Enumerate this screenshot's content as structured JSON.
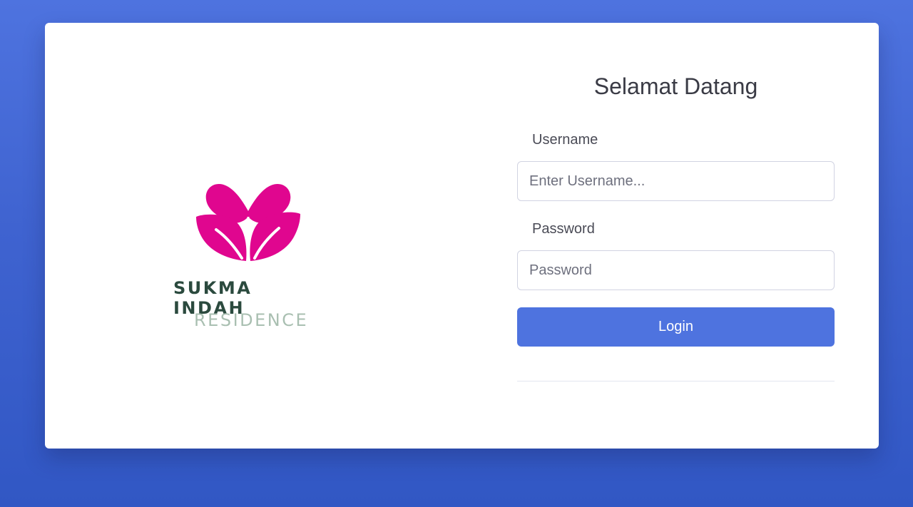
{
  "brand": {
    "name": "SUKMA INDAH",
    "subtitle": "RESIDENCE",
    "logo_icon": "lotus-heart-icon",
    "colors": {
      "logo": "#e0068f",
      "name": "#2b4a3e",
      "subtitle": "#a9bfb1"
    }
  },
  "form": {
    "title": "Selamat Datang",
    "username": {
      "label": "Username",
      "placeholder": "Enter Username...",
      "value": ""
    },
    "password": {
      "label": "Password",
      "placeholder": "Password",
      "value": ""
    },
    "submit_label": "Login"
  },
  "theme": {
    "background": "#4e73df",
    "primary": "#4e73df",
    "card": "#ffffff"
  }
}
